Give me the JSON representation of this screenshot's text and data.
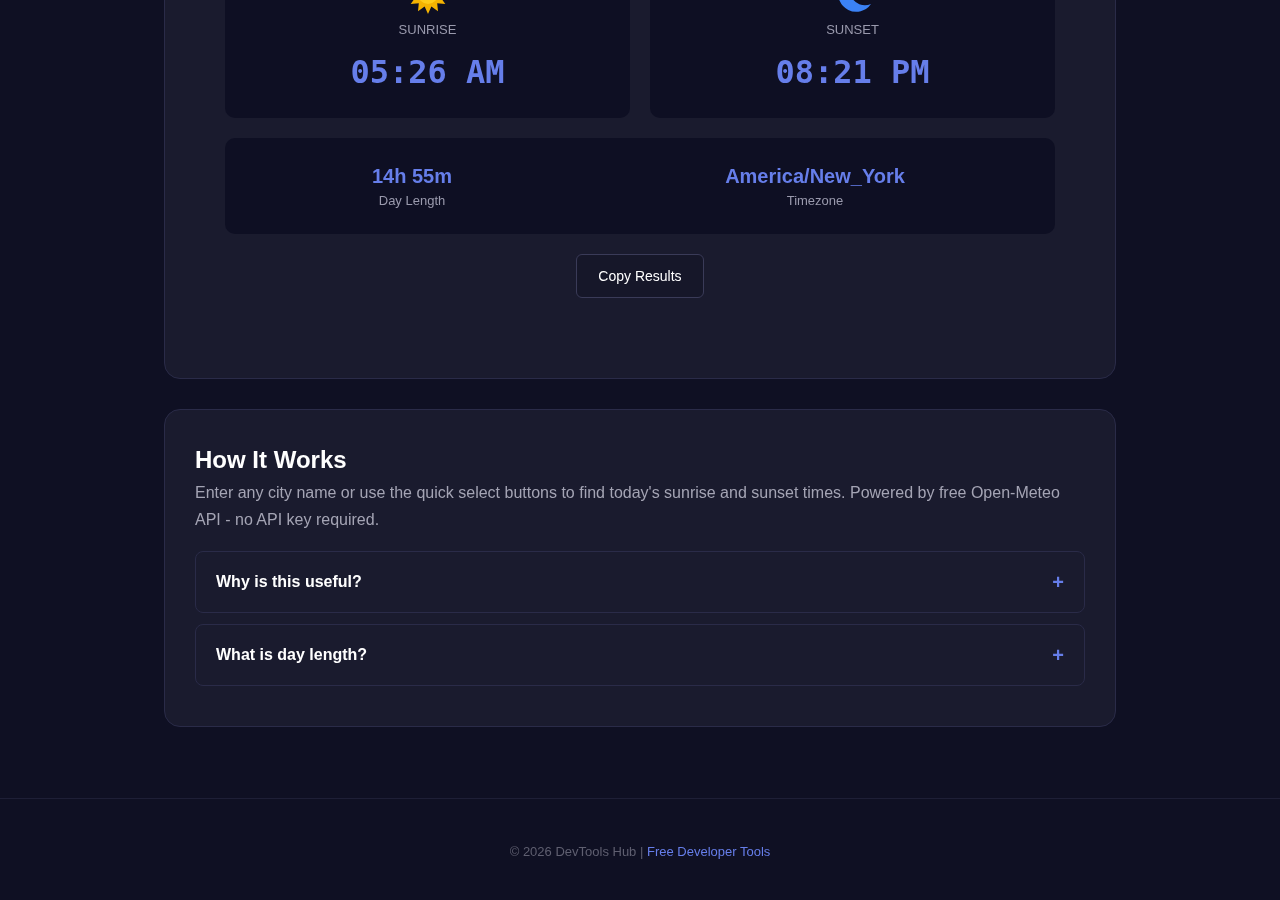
{
  "times": [
    {
      "kind": "sunrise",
      "label": "SUNRISE",
      "time": "05:26 AM"
    },
    {
      "kind": "sunset",
      "label": "SUNSET",
      "time": "08:21 PM"
    }
  ],
  "details": [
    {
      "value": "14h 55m",
      "label": "Day Length"
    },
    {
      "value": "America/New_York",
      "label": "Timezone"
    }
  ],
  "copy_button": "Copy Results",
  "how_it_works": {
    "title": "How It Works",
    "description": "Enter any city name or use the quick select buttons to find today's sunrise and sunset times. Powered by free Open-Meteo API - no API key required.",
    "faq": [
      {
        "question": "Why is this useful?",
        "toggle": "+",
        "expanded": false
      },
      {
        "question": "What is day length?",
        "toggle": "+",
        "expanded": false
      }
    ]
  },
  "footer": {
    "copyright": "© 2026 DevTools Hub |",
    "link": "Free Developer Tools"
  }
}
